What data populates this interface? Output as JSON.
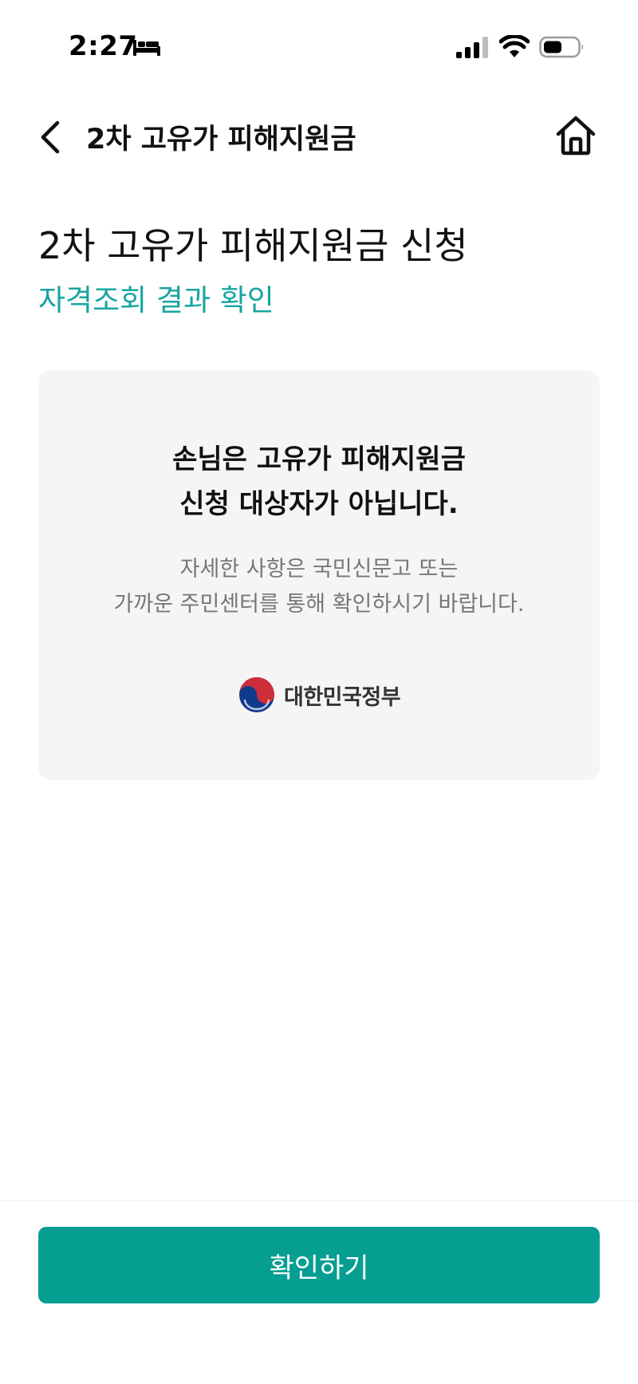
{
  "status_bar": {
    "time": "2:27",
    "icons": [
      "bed-icon",
      "cellular-signal-icon",
      "wifi-icon",
      "battery-icon"
    ]
  },
  "header": {
    "back_icon": "chevron-left-icon",
    "title": "2차 고유가 피해지원금",
    "home_icon": "home-icon"
  },
  "page": {
    "title": "2차 고유가 피해지원금 신청",
    "subtitle": "자격조회 결과 확인"
  },
  "result_card": {
    "heading_line1": "손님은 고유가 피해지원금",
    "heading_line2": "신청 대상자가 아닙니다.",
    "desc_line1": "자세한 사항은 국민신문고 또는",
    "desc_line2": "가까운 주민센터를 통해 확인하시기 바랍니다.",
    "gov_name": "대한민국정부",
    "gov_emblem_icon": "taegeuk-emblem-icon"
  },
  "footer": {
    "confirm_label": "확인하기"
  },
  "colors": {
    "accent_text": "#17a5a0",
    "button_bg": "#079e92",
    "card_bg": "#f5f5f5",
    "emblem_red": "#cd2e3a",
    "emblem_blue": "#0f3b8c"
  }
}
